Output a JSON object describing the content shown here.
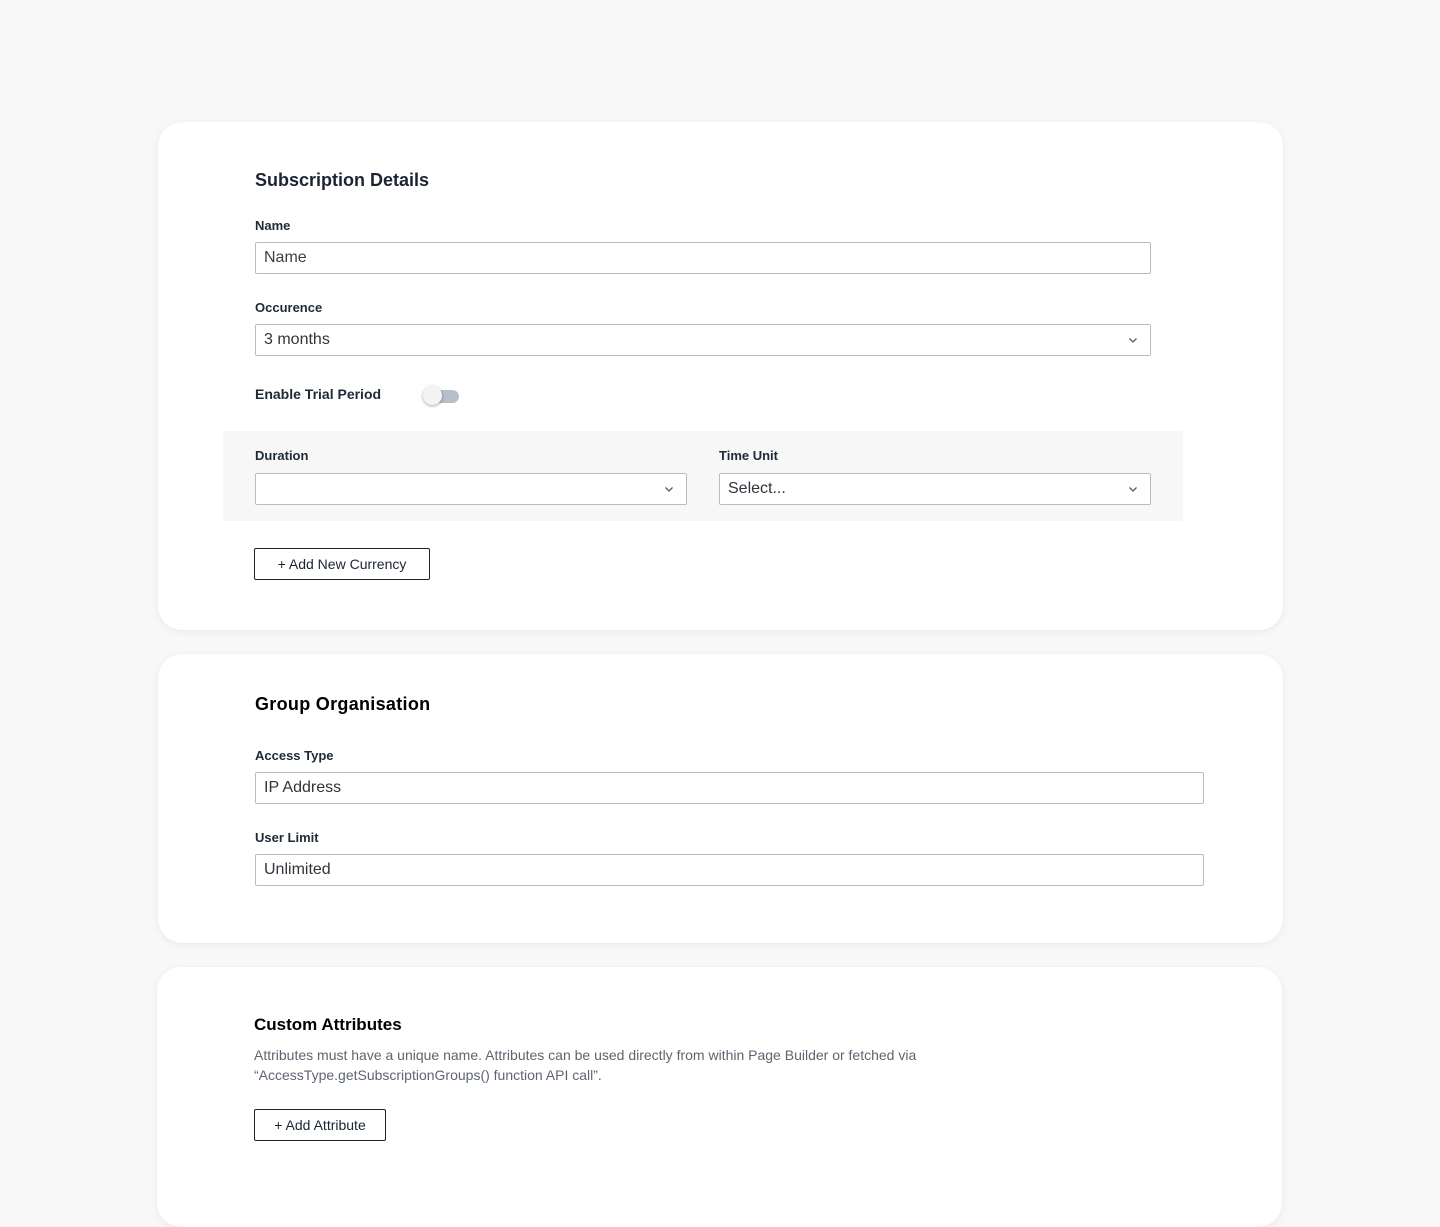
{
  "subscription": {
    "title": "Subscription Details",
    "name_label": "Name",
    "name_placeholder": "Name",
    "name_value": "",
    "occurrence_label": "Occurence",
    "occurrence_value": "3 months",
    "trial_label": "Enable Trial Period",
    "trial_enabled": false,
    "duration_label": "Duration",
    "duration_value": "",
    "time_unit_label": "Time Unit",
    "time_unit_value": "Select...",
    "add_currency_button": "+ Add New Currency"
  },
  "group": {
    "title": "Group Organisation",
    "access_type_label": "Access Type",
    "access_type_value": "IP Address",
    "user_limit_label": "User Limit",
    "user_limit_value": "Unlimited"
  },
  "custom_attributes": {
    "title": "Custom Attributes",
    "description": "Attributes must have a unique name. Attributes can be used directly from within Page Builder or fetched via “AccessType.getSubscriptionGroups() function API call”.",
    "add_attribute_button": "+ Add Attribute"
  },
  "icons": {
    "select_caret": "chevron-down-icon"
  },
  "colors": {
    "page_background": "#f8f8f8",
    "card_background": "#ffffff",
    "heading": "#1c2434",
    "toggle_off": "#b8bfca"
  }
}
